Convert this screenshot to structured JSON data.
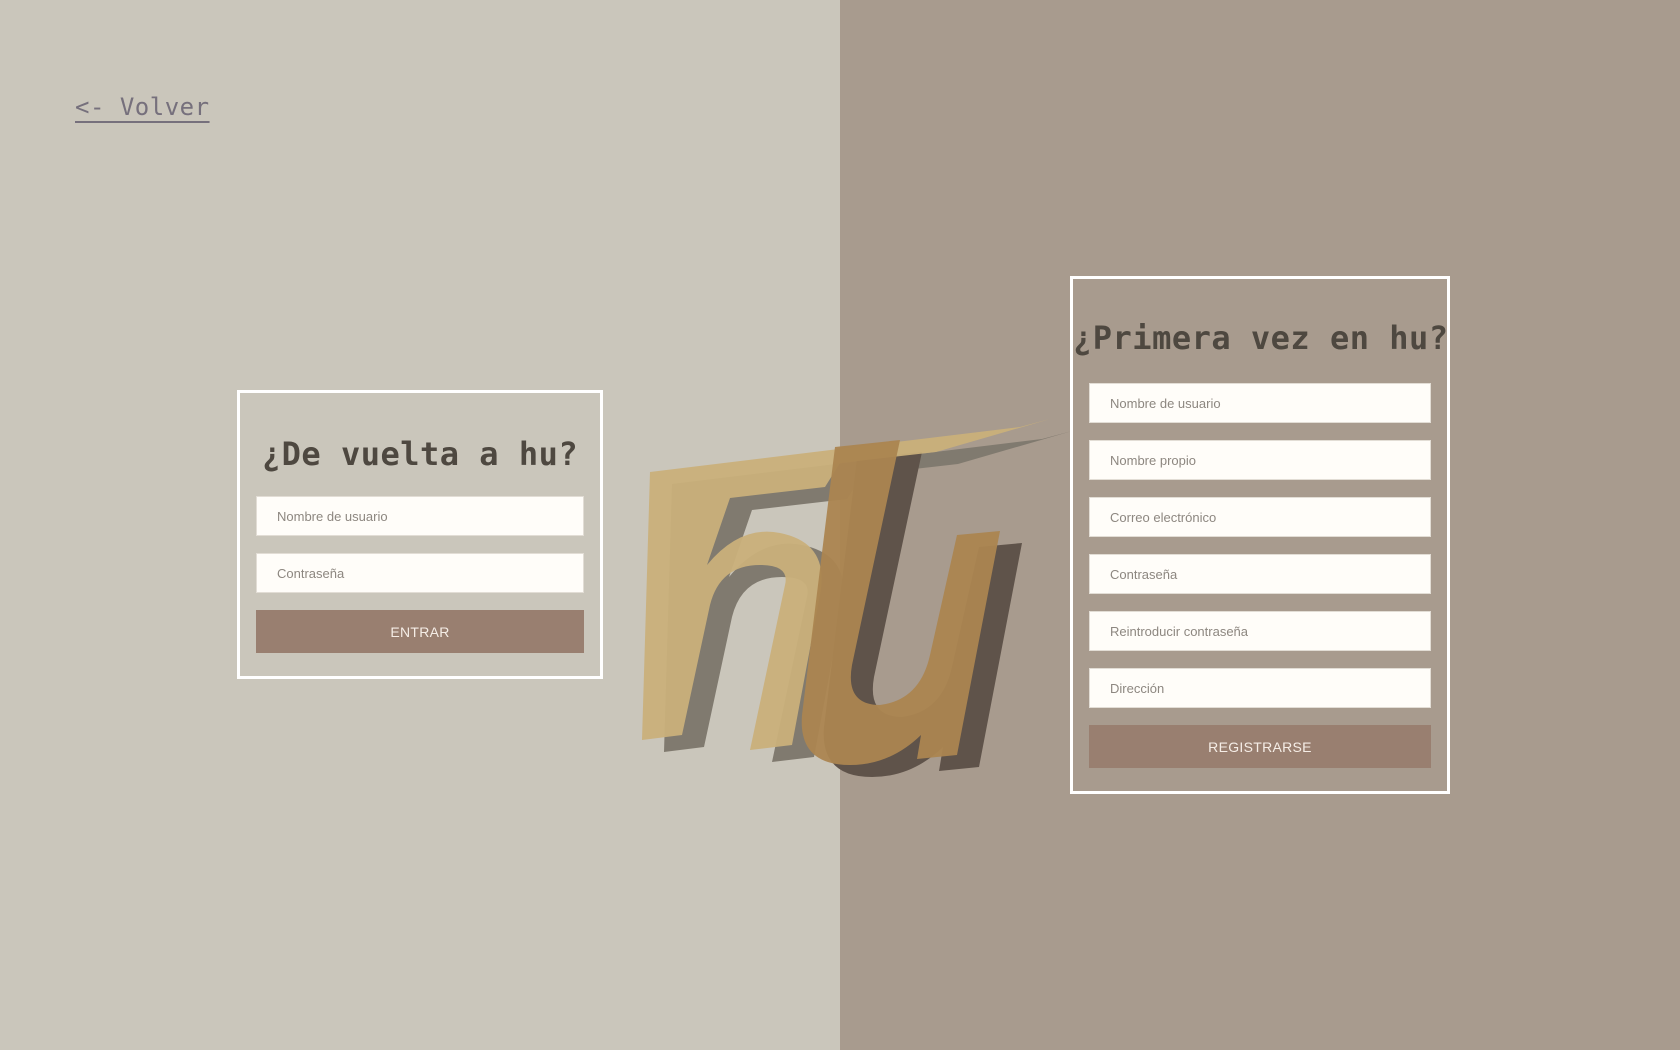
{
  "nav": {
    "back_label": "<- Volver"
  },
  "logo": {
    "text": "hu"
  },
  "login": {
    "title": "¿De vuelta a hu?",
    "username_placeholder": "Nombre de usuario",
    "password_placeholder": "Contraseña",
    "submit_label": "ENTRAR"
  },
  "register": {
    "title": "¿Primera vez en hu?",
    "username_placeholder": "Nombre de usuario",
    "name_placeholder": "Nombre propio",
    "email_placeholder": "Correo electrónico",
    "password_placeholder": "Contraseña",
    "password_confirm_placeholder": "Reintroducir contraseña",
    "address_placeholder": "Dirección",
    "submit_label": "REGISTRARSE"
  },
  "colors": {
    "left_background": "#cac6bb",
    "right_background": "#a89b8e",
    "button": "#997f70",
    "logo_gold": "#c9b07a",
    "logo_shadow": "#5f534a"
  }
}
